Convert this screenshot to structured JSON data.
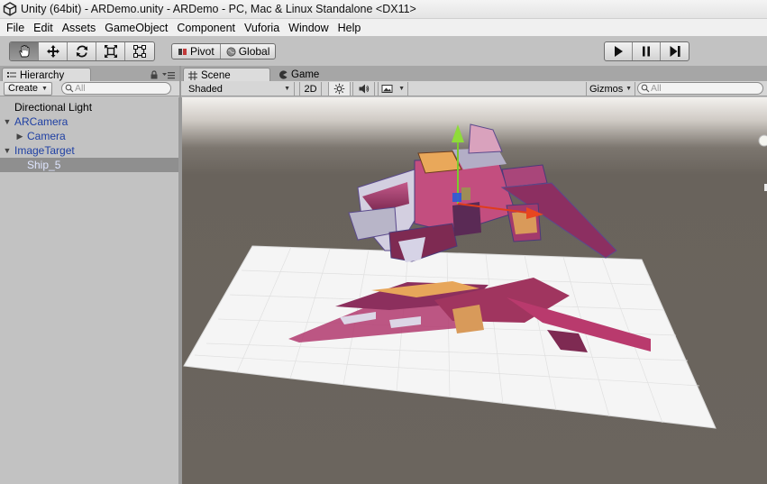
{
  "window": {
    "title": "Unity (64bit) - ARDemo.unity - ARDemo - PC, Mac & Linux Standalone <DX11>"
  },
  "menu": [
    {
      "label": "File"
    },
    {
      "label": "Edit"
    },
    {
      "label": "Assets"
    },
    {
      "label": "GameObject"
    },
    {
      "label": "Component"
    },
    {
      "label": "Vuforia"
    },
    {
      "label": "Window"
    },
    {
      "label": "Help"
    }
  ],
  "toolbar": {
    "transform_tools": [
      "hand-icon",
      "move-icon",
      "rotate-icon",
      "scale-icon",
      "rect-icon"
    ],
    "pivot_label": "Pivot",
    "global_label": "Global",
    "playback": [
      "play-icon",
      "pause-icon",
      "step-icon"
    ]
  },
  "hierarchy": {
    "tab_label": "Hierarchy",
    "create_label": "Create",
    "search_placeholder": "All",
    "items": [
      {
        "label": "Directional Light",
        "indent": 0,
        "foldout": "",
        "color": "normal"
      },
      {
        "label": "ARCamera",
        "indent": 0,
        "foldout": "▼",
        "color": "blue"
      },
      {
        "label": "Camera",
        "indent": 1,
        "foldout": "▶",
        "color": "blue"
      },
      {
        "label": "ImageTarget",
        "indent": 0,
        "foldout": "▼",
        "color": "blue"
      },
      {
        "label": "Ship_5",
        "indent": 1,
        "foldout": "",
        "color": "selected"
      }
    ]
  },
  "scene": {
    "tabs": [
      {
        "label": "Scene",
        "icon": "grid-icon",
        "active": true
      },
      {
        "label": "Game",
        "icon": "pacman-icon",
        "active": false
      }
    ],
    "shading_mode": "Shaded",
    "mode_2d_label": "2D",
    "gizmos_label": "Gizmos",
    "search_placeholder": "All"
  },
  "colors": {
    "editor_bg": "#c2c2c2",
    "scene_bg": "#6b655e",
    "selection": "#8f8f8f",
    "prefab_blue": "#1e3fa3",
    "ship_magenta": "#a8376b",
    "gizmo_green": "#7acb2d",
    "gizmo_red": "#e03c1c",
    "gizmo_blue": "#2a5bd9"
  }
}
